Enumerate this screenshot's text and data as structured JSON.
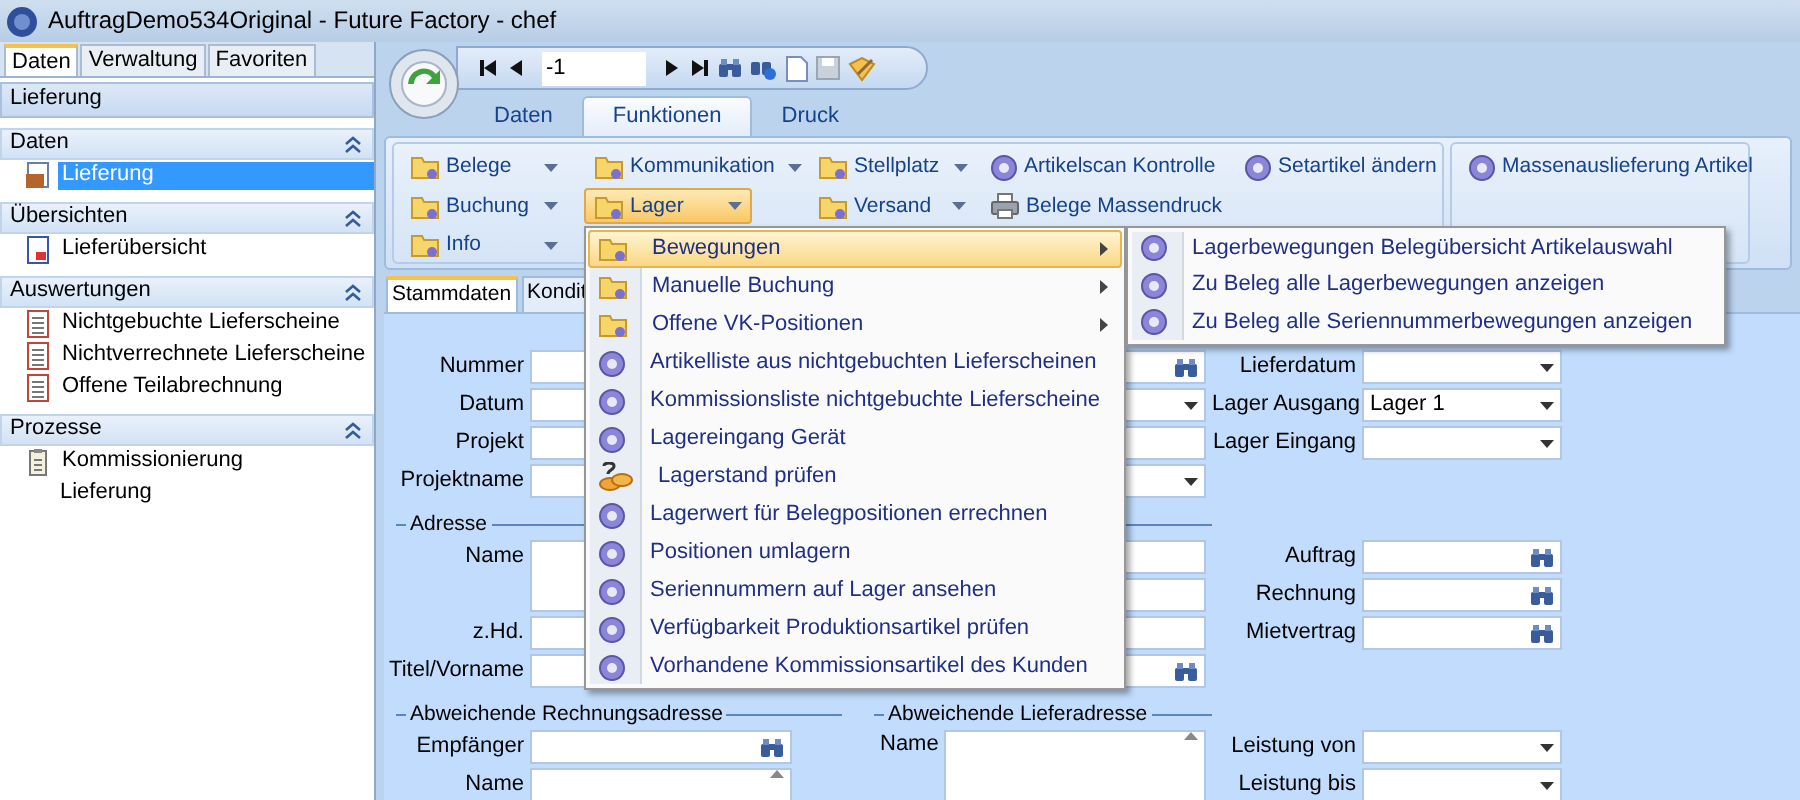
{
  "window": {
    "title": "AuftragDemo534Original - Future Factory - chef"
  },
  "sidebar": {
    "tabs": [
      {
        "label": "Daten",
        "selected": true
      },
      {
        "label": "Verwaltung",
        "selected": false
      },
      {
        "label": "Favoriten",
        "selected": false
      }
    ],
    "header": "Lieferung",
    "sections": [
      {
        "title": "Daten",
        "expanded": true,
        "items": [
          {
            "label": "Lieferung",
            "kind": "box",
            "selected": true
          }
        ]
      },
      {
        "title": "Übersichten",
        "expanded": true,
        "items": [
          {
            "label": "Lieferübersicht",
            "kind": "overview",
            "selected": false
          }
        ]
      },
      {
        "title": "Auswertungen",
        "expanded": true,
        "items": [
          {
            "label": "Nichtgebuchte Lieferscheine",
            "kind": "report",
            "selected": false
          },
          {
            "label": "Nichtverrechnete Lieferscheine",
            "kind": "report",
            "selected": false
          },
          {
            "label": "Offene Teilabrechnung",
            "kind": "report",
            "selected": false
          }
        ]
      },
      {
        "title": "Prozesse",
        "expanded": true,
        "items": [
          {
            "label": "Kommissionierung",
            "kind": "clipboard",
            "selected": false
          },
          {
            "label": "Lieferung",
            "kind": "plain",
            "selected": false
          }
        ]
      }
    ]
  },
  "toolbar": {
    "record": "-1"
  },
  "ribbon": {
    "tabs": [
      {
        "label": "Daten",
        "selected": false
      },
      {
        "label": "Funktionen",
        "selected": true
      },
      {
        "label": "Druck",
        "selected": false
      }
    ],
    "groups": [
      {
        "rows": [
          [
            {
              "label": "Belege",
              "kind": "dropdown",
              "open": false
            },
            {
              "label": "Kommunikation",
              "kind": "dropdown",
              "open": false
            },
            {
              "label": "Stellplatz",
              "kind": "dropdown",
              "open": false
            },
            {
              "label": "Artikelscan Kontrolle",
              "kind": "action",
              "open": false
            },
            {
              "label": "Setartikel ändern",
              "kind": "action",
              "open": false
            }
          ],
          [
            {
              "label": "Buchung",
              "kind": "dropdown",
              "open": false
            },
            {
              "label": "Lager",
              "kind": "dropdown",
              "open": true
            },
            {
              "label": "Versand",
              "kind": "dropdown",
              "open": false
            },
            {
              "label": "Belege Massendruck",
              "kind": "print",
              "open": false
            }
          ],
          [
            {
              "label": "Info",
              "kind": "dropdown",
              "open": false
            }
          ]
        ]
      },
      {
        "rows": [
          [
            {
              "label": "Massenauslieferung Artikel",
              "kind": "action",
              "open": false
            }
          ]
        ]
      }
    ]
  },
  "form": {
    "tabs": [
      {
        "label": "Stammdaten",
        "selected": true
      },
      {
        "label": "Kondit",
        "selected": false
      }
    ],
    "main_fields": [
      {
        "label": "Nummer",
        "kind": "lookup"
      },
      {
        "label": "Datum",
        "kind": "dropdown"
      },
      {
        "label": "Projekt",
        "kind": "text"
      },
      {
        "label": "Projektname",
        "kind": "dropdown"
      }
    ],
    "delivery_fields": [
      {
        "label": "Lieferdatum",
        "kind": "dropdown"
      },
      {
        "label": "Lager Ausgang",
        "kind": "dropdown",
        "value": "Lager 1"
      },
      {
        "label": "Lager Eingang",
        "kind": "dropdown"
      }
    ],
    "address": {
      "legend": "Adresse",
      "fields": [
        {
          "label": "Name",
          "kind": "memo"
        },
        {
          "label": "z.Hd.",
          "kind": "text"
        },
        {
          "label": "Titel/Vorname",
          "kind": "text"
        }
      ],
      "fields_2": [
        {
          "kind": "text"
        },
        {
          "kind": "text"
        },
        {
          "kind": "text"
        },
        {
          "kind": "lookup"
        }
      ],
      "links": [
        {
          "label": "Auftrag",
          "kind": "lookup"
        },
        {
          "label": "Rechnung",
          "kind": "lookup"
        },
        {
          "label": "Mietvertrag",
          "kind": "lookup"
        }
      ]
    },
    "billing_address": {
      "legend": "Abweichende Rechnungsadresse",
      "fields": [
        {
          "label": "Empfänger",
          "kind": "lookup"
        },
        {
          "label": "Name",
          "kind": "memo"
        }
      ]
    },
    "shipping_address": {
      "legend": "Abweichende Lieferadresse",
      "fields": [
        {
          "label": "Name",
          "kind": "memo"
        }
      ]
    },
    "service": [
      {
        "label": "Leistung von",
        "kind": "dropdown"
      },
      {
        "label": "Leistung bis",
        "kind": "dropdown"
      }
    ]
  },
  "menu": {
    "items": [
      {
        "label": "Bewegungen",
        "kind": "submenu",
        "selected": true
      },
      {
        "label": "Manuelle Buchung",
        "kind": "submenu",
        "selected": false
      },
      {
        "label": "Offene VK-Positionen",
        "kind": "submenu",
        "selected": false
      },
      {
        "label": "Artikelliste aus nichtgebuchten Lieferscheinen",
        "kind": "action",
        "selected": false
      },
      {
        "label": "Kommissionsliste nichtgebuchte Lieferscheine",
        "kind": "action",
        "selected": false
      },
      {
        "label": "Lagereingang Gerät",
        "kind": "action",
        "selected": false
      },
      {
        "label": "Lagerstand prüfen",
        "kind": "check",
        "selected": false
      },
      {
        "label": "Lagerwert für Belegpositionen errechnen",
        "kind": "action",
        "selected": false
      },
      {
        "label": "Positionen umlagern",
        "kind": "action",
        "selected": false
      },
      {
        "label": "Seriennummern auf Lager ansehen",
        "kind": "action",
        "selected": false
      },
      {
        "label": "Verfügbarkeit Produktionsartikel prüfen",
        "kind": "action",
        "selected": false
      },
      {
        "label": "Vorhandene Kommissionsartikel des Kunden",
        "kind": "action",
        "selected": false
      }
    ]
  },
  "submenu": {
    "items": [
      {
        "label": "Lagerbewegungen Belegübersicht Artikelauswahl",
        "kind": "action",
        "selected": false
      },
      {
        "label": "Zu Beleg alle Lagerbewegungen anzeigen",
        "kind": "action",
        "selected": false
      },
      {
        "label": "Zu Beleg alle Seriennummerbewegungen anzeigen",
        "kind": "action",
        "selected": false
      }
    ]
  }
}
